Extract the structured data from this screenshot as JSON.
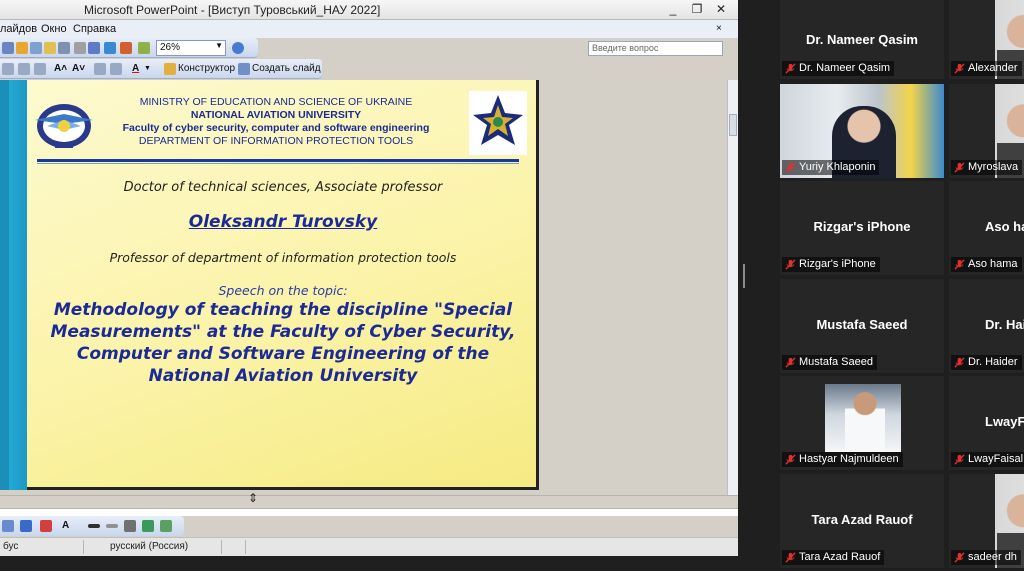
{
  "window": {
    "title": "Microsoft PowerPoint - [Виступ Туровський_НАУ 2022]",
    "controls": [
      "_",
      "❐",
      "✕"
    ]
  },
  "menu": {
    "items": [
      "лайдов",
      "Окно",
      "Справка"
    ],
    "help_placeholder": "Введите вопрос",
    "close": "×"
  },
  "toolbar": {
    "zoom": "26%",
    "designer_label": "Конструктор",
    "new_slide_label": "Создать слайд"
  },
  "slide": {
    "ministry": "MINISTRY OF EDUCATION AND SCIENCE OF UKRAINE",
    "university": "NATIONAL AVIATION UNIVERSITY",
    "faculty": "Faculty of cyber security, computer and software engineering",
    "department": "DEPARTMENT OF INFORMATION PROTECTION TOOLS",
    "degree": "Doctor of technical sciences, Associate professor",
    "speaker": "Oleksandr Turovsky",
    "position": "Professor of  department of information protection tools",
    "speech_label": "Speech on the topic:",
    "topic": "Methodology of teaching the discipline \"Special Measurements\" at the Faculty of Cyber Security, Computer and Software Engineering of the National Aviation University"
  },
  "status": {
    "left": "бус",
    "language": "русский (Россия)"
  },
  "participants": [
    {
      "name": "Dr. Nameer Qasim",
      "label": "Dr. Nameer Qasim",
      "video": false
    },
    {
      "name": "Alexander",
      "label": "Alexander",
      "video": true
    },
    {
      "name": "Yuriy Khlaponin",
      "label": "Yuriy Khlaponin",
      "video": true
    },
    {
      "name": "Myroslava",
      "label": "Myroslava",
      "video": true
    },
    {
      "name": "Rizgar's iPhone",
      "label": "Rizgar's iPhone",
      "video": false
    },
    {
      "name": "Aso ha",
      "label": "Aso hama",
      "video": false
    },
    {
      "name": "Mustafa Saeed",
      "label": "Mustafa Saeed",
      "video": false
    },
    {
      "name": "Dr. Haid",
      "label": "Dr. Haider",
      "video": false
    },
    {
      "name": "Hastyar Najmuldeen",
      "label": "Hastyar Najmuldeen",
      "video": true
    },
    {
      "name": "LwayFai",
      "label": "LwayFaisal Ab",
      "video": false
    },
    {
      "name": "Tara Azad Rauof",
      "label": "Tara Azad Rauof",
      "video": false
    },
    {
      "name": "sadeer dh",
      "label": "sadeer dh",
      "video": true
    }
  ]
}
